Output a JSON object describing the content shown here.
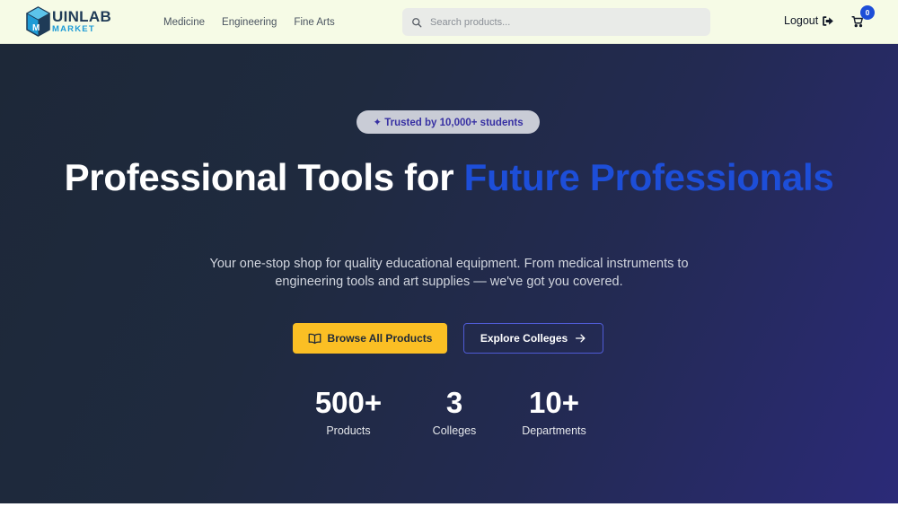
{
  "header": {
    "logo": {
      "main": "UINLAB",
      "sub": "MARKET"
    },
    "nav": [
      {
        "label": "Medicine"
      },
      {
        "label": "Engineering"
      },
      {
        "label": "Fine Arts"
      }
    ],
    "search": {
      "placeholder": "Search products...",
      "value": ""
    },
    "logout_label": "Logout",
    "cart_count": "0"
  },
  "hero": {
    "badge": "✦ Trusted by 10,000+ students",
    "title_part1": "Professional Tools for ",
    "title_accent": "Future Professionals",
    "subtitle": "Your one-stop shop for quality educational equipment. From medical instruments to engineering tools and art supplies — we've got you covered.",
    "primary_button": "Browse All Products",
    "secondary_button": "Explore Colleges",
    "stats": [
      {
        "value": "500+",
        "label": "Products"
      },
      {
        "value": "3",
        "label": "Colleges"
      },
      {
        "value": "10+",
        "label": "Departments"
      }
    ]
  },
  "colors": {
    "accent_blue": "#1d4ed8",
    "primary_yellow": "#fbbf24",
    "header_bg": "#f6fbe6"
  }
}
